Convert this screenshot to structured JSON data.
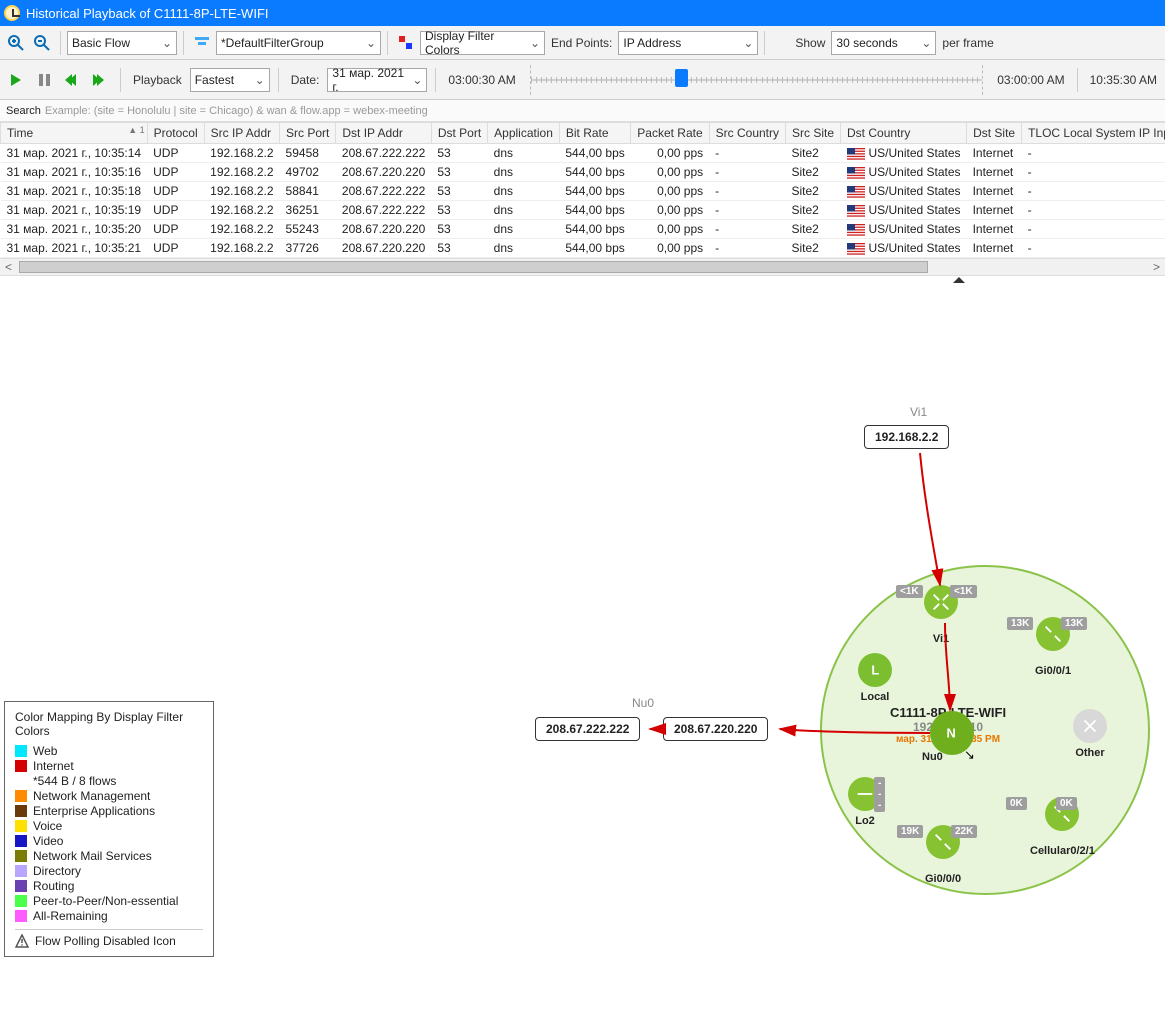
{
  "title": "Historical Playback of C1111-8P-LTE-WIFI",
  "toolbar": {
    "basic_flow": "Basic Flow",
    "filter_group": "*DefaultFilterGroup",
    "display_colors": "Display Filter Colors",
    "endpoints_label": "End Points:",
    "endpoints_value": "IP Address",
    "show_label": "Show",
    "show_value": "30 seconds",
    "per_frame": "per frame"
  },
  "playback": {
    "label": "Playback",
    "speed": "Fastest",
    "date_label": "Date:",
    "date_value": "31 мар. 2021 г.",
    "time_left": "03:00:30 AM",
    "time_right1": "03:00:00 AM",
    "time_right2": "10:35:30 AM"
  },
  "search": {
    "label": "Search",
    "placeholder": "Example: (site = Honolulu | site = Chicago) & wan & flow.app = webex-meeting"
  },
  "columns": [
    "Time",
    "Protocol",
    "Src IP Addr",
    "Src Port",
    "Dst IP Addr",
    "Dst Port",
    "Application",
    "Bit Rate",
    "Packet Rate",
    "Src Country",
    "Src Site",
    "Dst Country",
    "Dst Site",
    "TLOC Local System IP Input"
  ],
  "rows": [
    {
      "time": "31 мар. 2021 г., 10:35:14",
      "proto": "UDP",
      "sip": "192.168.2.2",
      "sport": "59458",
      "dip": "208.67.222.222",
      "dport": "53",
      "app": "dns",
      "bit": "544,00 bps",
      "pkt": "0,00 pps",
      "scountry": "-",
      "ssite": "Site2",
      "dcountry": "US/United States",
      "dsite": "Internet",
      "tloc": "-"
    },
    {
      "time": "31 мар. 2021 г., 10:35:16",
      "proto": "UDP",
      "sip": "192.168.2.2",
      "sport": "49702",
      "dip": "208.67.220.220",
      "dport": "53",
      "app": "dns",
      "bit": "544,00 bps",
      "pkt": "0,00 pps",
      "scountry": "-",
      "ssite": "Site2",
      "dcountry": "US/United States",
      "dsite": "Internet",
      "tloc": "-"
    },
    {
      "time": "31 мар. 2021 г., 10:35:18",
      "proto": "UDP",
      "sip": "192.168.2.2",
      "sport": "58841",
      "dip": "208.67.222.222",
      "dport": "53",
      "app": "dns",
      "bit": "544,00 bps",
      "pkt": "0,00 pps",
      "scountry": "-",
      "ssite": "Site2",
      "dcountry": "US/United States",
      "dsite": "Internet",
      "tloc": "-"
    },
    {
      "time": "31 мар. 2021 г., 10:35:19",
      "proto": "UDP",
      "sip": "192.168.2.2",
      "sport": "36251",
      "dip": "208.67.222.222",
      "dport": "53",
      "app": "dns",
      "bit": "544,00 bps",
      "pkt": "0,00 pps",
      "scountry": "-",
      "ssite": "Site2",
      "dcountry": "US/United States",
      "dsite": "Internet",
      "tloc": "-"
    },
    {
      "time": "31 мар. 2021 г., 10:35:20",
      "proto": "UDP",
      "sip": "192.168.2.2",
      "sport": "55243",
      "dip": "208.67.220.220",
      "dport": "53",
      "app": "dns",
      "bit": "544,00 bps",
      "pkt": "0,00 pps",
      "scountry": "-",
      "ssite": "Site2",
      "dcountry": "US/United States",
      "dsite": "Internet",
      "tloc": "-"
    },
    {
      "time": "31 мар. 2021 г., 10:35:21",
      "proto": "UDP",
      "sip": "192.168.2.2",
      "sport": "37726",
      "dip": "208.67.220.220",
      "dport": "53",
      "app": "dns",
      "bit": "544,00 bps",
      "pkt": "0,00 pps",
      "scountry": "-",
      "ssite": "Site2",
      "dcountry": "US/United States",
      "dsite": "Internet",
      "tloc": "-"
    }
  ],
  "legend": {
    "title": "Color Mapping By Display Filter Colors",
    "items": [
      {
        "color": "#00e7ff",
        "label": "Web"
      },
      {
        "color": "#d40000",
        "label": "Internet"
      },
      {
        "color": "",
        "label": "*544 B / 8 flows",
        "indent": true
      },
      {
        "color": "#ff8c00",
        "label": "Network Management"
      },
      {
        "color": "#6b3a0b",
        "label": "Enterprise Applications"
      },
      {
        "color": "#ffe000",
        "label": "Voice"
      },
      {
        "color": "#1717c4",
        "label": "Video"
      },
      {
        "color": "#7b7b00",
        "label": "Network Mail Services"
      },
      {
        "color": "#b9a6ff",
        "label": "Directory"
      },
      {
        "color": "#6a3fb0",
        "label": "Routing"
      },
      {
        "color": "#4bff4b",
        "label": "Peer-to-Peer/Non-essential"
      },
      {
        "color": "#ff5cff",
        "label": "All-Remaining"
      }
    ],
    "footer": "Flow Polling Disabled Icon"
  },
  "topo": {
    "vi1_label": "Vi1",
    "vi1_ip": "192.168.2.2",
    "nu0_label": "Nu0",
    "nu0_ip1": "208.67.222.222",
    "nu0_ip2": "208.67.220.220",
    "device_name": "C1111-8P-LTE-WIFI",
    "device_ip": "192.168.1.10",
    "device_ts": "мар. 31, 2021 6:35 PM",
    "if_labels": {
      "vi1": "Vi1",
      "gi001": "Gi0/0/1",
      "nu0": "Nu0",
      "local": "Local",
      "lo2": "Lo2",
      "gi000": "Gi0/0/0",
      "cell": "Cellular0/2/1",
      "other": "Other"
    },
    "tags": {
      "vi1_a": "<1K",
      "vi1_b": "<1K",
      "gi001_a": "13K",
      "gi001_b": "13K",
      "gi000_a": "19K",
      "gi000_b": "22K",
      "cell_a": "0K",
      "cell_b": "0K",
      "lo2": "---",
      "local": "---"
    }
  }
}
